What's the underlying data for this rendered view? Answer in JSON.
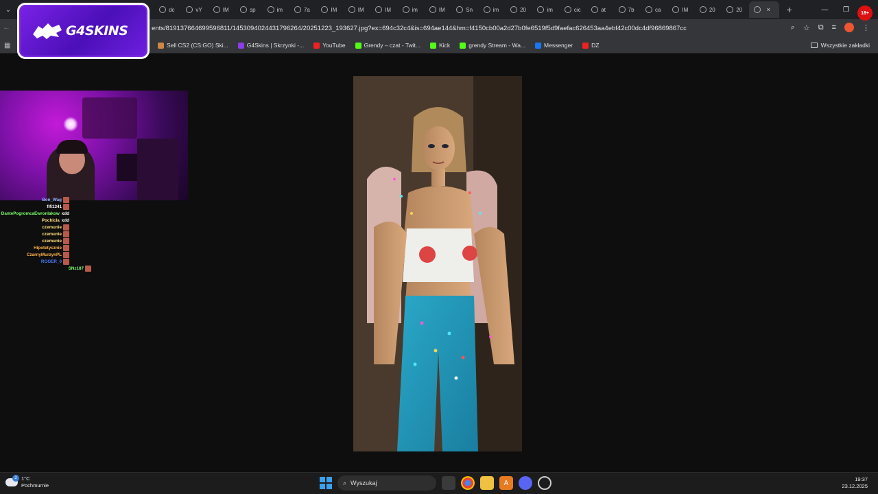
{
  "browser": {
    "tabs": [
      {
        "label": "dc"
      },
      {
        "label": "vY"
      },
      {
        "label": "IM"
      },
      {
        "label": "sp"
      },
      {
        "label": "im"
      },
      {
        "label": "7a"
      },
      {
        "label": "IM"
      },
      {
        "label": "IM"
      },
      {
        "label": "IM"
      },
      {
        "label": "im"
      },
      {
        "label": "IM"
      },
      {
        "label": "Sn"
      },
      {
        "label": "im"
      },
      {
        "label": "20"
      },
      {
        "label": "im"
      },
      {
        "label": "cic"
      },
      {
        "label": "at"
      },
      {
        "label": "7b"
      },
      {
        "label": "ca"
      },
      {
        "label": "IM"
      },
      {
        "label": "20"
      },
      {
        "label": "20"
      }
    ],
    "active_tab_close": "×",
    "new_tab": "+",
    "window_controls": {
      "minimize": "—",
      "restore": "❐",
      "close": "✕"
    },
    "profile_badge": "18+",
    "url": "ents/819137664699596811/1453094024431796264/20251223_193627.jpg?ex=694c32c4&is=694ae144&hm=f4150cb00a2d27b0fe6519f5d9faefac626453aa4ebf42c00dc4df96869867cc",
    "nav_icons": {
      "zoom": "⌕",
      "star": "☆",
      "extensions": "⧉",
      "menu": "⋮"
    },
    "bookmarks": [
      {
        "label": "Sell CS2 (CS:GO) Ski...",
        "color": "#c84"
      },
      {
        "label": "G4Skins | Skrzynki -...",
        "color": "#8a3de8"
      },
      {
        "label": "YouTube",
        "color": "#e22"
      },
      {
        "label": "Grendy – czat - Twit...",
        "color": "#53fc18"
      },
      {
        "label": "Kick",
        "color": "#53fc18"
      },
      {
        "label": "grendy Stream - Wa...",
        "color": "#53fc18"
      },
      {
        "label": "Messenger",
        "color": "#1877f2"
      },
      {
        "label": "DZ",
        "color": "#e22"
      }
    ],
    "all_bookmarks": "Wszystkie zakładki"
  },
  "overlay": {
    "logo_text": "G4SKINS"
  },
  "chat": [
    {
      "user": "Bon_Wag",
      "color": "#8fb3ff",
      "msg": ""
    },
    {
      "user": "fifi1341",
      "color": "#ffffff",
      "msg": ""
    },
    {
      "user": "DantePogromcaEwronlakow",
      "color": "#7cff6a",
      "msg": "xdd"
    },
    {
      "user": "Pochicla",
      "color": "#ffe07a",
      "msg": "xdd"
    },
    {
      "user": "czemunie",
      "color": "#ffe07a",
      "msg": ""
    },
    {
      "user": "czemunie",
      "color": "#ffe07a",
      "msg": ""
    },
    {
      "user": "czemunie",
      "color": "#ffe07a",
      "msg": ""
    },
    {
      "user": "Hipotetycznie",
      "color": "#ffb44a",
      "msg": ""
    },
    {
      "user": "CzarnyMurzynPL",
      "color": "#ffb44a",
      "msg": ""
    },
    {
      "user": "ROGER_0",
      "color": "#4a7bff",
      "msg": ""
    },
    {
      "user": "SNz187",
      "color": "#7cff6a",
      "msg": ""
    }
  ],
  "taskbar": {
    "temperature": "1°C",
    "weather": "Pochmurnie",
    "weather_badge": "2",
    "search_placeholder": "Wyszukaj",
    "time": "19:37",
    "date": "23.12.2025"
  }
}
